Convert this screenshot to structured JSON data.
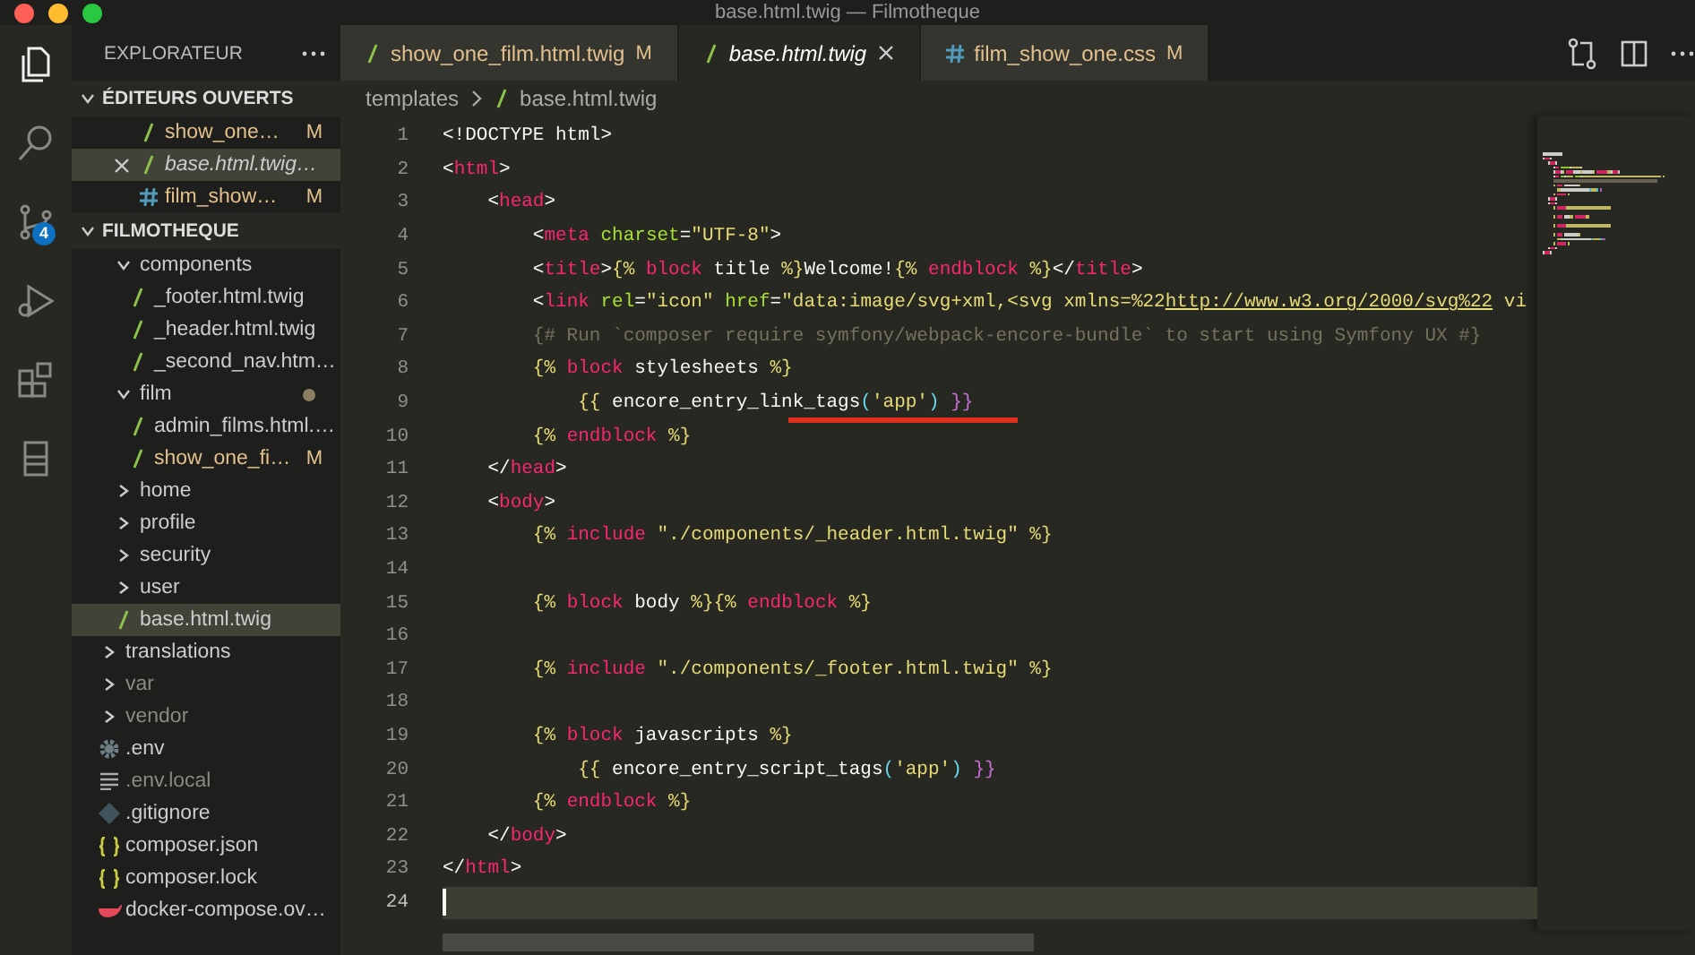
{
  "window": {
    "title": "base.html.twig — Filmotheque"
  },
  "activity_bar": [
    {
      "kind": "files",
      "selected": true
    },
    {
      "kind": "search",
      "selected": false
    },
    {
      "kind": "source-control",
      "selected": false,
      "badge": "4"
    },
    {
      "kind": "run",
      "selected": false
    },
    {
      "kind": "extensions",
      "selected": false
    },
    {
      "kind": "database",
      "selected": false
    }
  ],
  "sidebar": {
    "title": "EXPLORATEUR",
    "open_editors": {
      "title": "ÉDITEURS OUVERTS",
      "expanded": true,
      "items": [
        {
          "label": "show_one…",
          "kind": "twig",
          "badge": "M",
          "selected": false,
          "preview": false
        },
        {
          "label": "base.html.twig…",
          "kind": "twig",
          "selected": true,
          "preview": true
        },
        {
          "label": "film_show…",
          "kind": "css",
          "badge": "M",
          "selected": false,
          "preview": false
        }
      ]
    },
    "folder": {
      "title": "FILMOTHEQUE",
      "expanded": true,
      "tree": [
        {
          "children": [
            {
              "label": "components",
              "kind": "folder",
              "expanded": true,
              "dimmed": false,
              "selected": false,
              "children": [
                {
                  "label": "_footer.html.twig",
                  "kind": "twig",
                  "dimmed": false,
                  "selected": false
                },
                {
                  "label": "_header.html.twig",
                  "kind": "twig",
                  "dimmed": false,
                  "selected": false
                },
                {
                  "label": "_second_nav.htm…",
                  "kind": "twig",
                  "dimmed": false,
                  "selected": false
                }
              ]
            },
            {
              "label": "film",
              "kind": "folder",
              "expanded": true,
              "dimmed": false,
              "selected": false,
              "modified": true,
              "children": [
                {
                  "label": "admin_films.html.…",
                  "kind": "twig",
                  "dimmed": false,
                  "selected": false
                },
                {
                  "label": "show_one_fi…",
                  "kind": "twig",
                  "badge": "M",
                  "dimmed": false,
                  "selected": false
                }
              ]
            },
            {
              "label": "home",
              "kind": "folder",
              "expanded": false,
              "dimmed": false,
              "selected": false
            },
            {
              "label": "profile",
              "kind": "folder",
              "expanded": false,
              "dimmed": false,
              "selected": false
            },
            {
              "label": "security",
              "kind": "folder",
              "expanded": false,
              "dimmed": false,
              "selected": false
            },
            {
              "label": "user",
              "kind": "folder",
              "expanded": false,
              "dimmed": false,
              "selected": false
            },
            {
              "label": "base.html.twig",
              "kind": "twig",
              "dimmed": false,
              "selected": true
            }
          ]
        },
        {
          "label": "translations",
          "kind": "folder",
          "expanded": false,
          "dimmed": false,
          "selected": false
        },
        {
          "label": "var",
          "kind": "folder",
          "expanded": false,
          "dimmed": true,
          "selected": false
        },
        {
          "label": "vendor",
          "kind": "folder",
          "expanded": false,
          "dimmed": true,
          "selected": false
        },
        {
          "label": ".env",
          "kind": "gear",
          "dimmed": false,
          "selected": false
        },
        {
          "label": ".env.local",
          "kind": "lines",
          "dimmed": true,
          "selected": false
        },
        {
          "label": ".gitignore",
          "kind": "git",
          "dimmed": false,
          "selected": false
        },
        {
          "label": "composer.json",
          "kind": "json",
          "dimmed": false,
          "selected": false
        },
        {
          "label": "composer.lock",
          "kind": "json",
          "dimmed": false,
          "selected": false
        },
        {
          "label": "docker-compose.ov…",
          "kind": "docker",
          "dimmed": false,
          "selected": false
        }
      ]
    }
  },
  "tabs": [
    {
      "label": "show_one_film.html.twig",
      "kind": "twig",
      "badge": "M",
      "selected": false,
      "preview": false
    },
    {
      "label": "base.html.twig",
      "kind": "twig",
      "selected": true,
      "preview": true
    },
    {
      "label": "film_show_one.css",
      "kind": "css",
      "badge": "M",
      "selected": false,
      "preview": false
    }
  ],
  "breadcrumb": [
    {
      "label": "templates",
      "kind": "folder"
    },
    {
      "label": "base.html.twig",
      "kind": "twig"
    }
  ],
  "editor": {
    "lines": [
      {
        "number": "1",
        "current": false,
        "underlined": false,
        "tokens": [
          {
            "kind": "plain",
            "text": "<!DOCTYPE html>"
          }
        ]
      },
      {
        "number": "2",
        "current": false,
        "underlined": false,
        "tokens": [
          {
            "kind": "plain",
            "text": "<"
          },
          {
            "kind": "tag",
            "text": "html"
          },
          {
            "kind": "plain",
            "text": ">"
          }
        ]
      },
      {
        "number": "3",
        "current": false,
        "underlined": false,
        "tokens": [
          {
            "kind": "plain",
            "text": "    <"
          },
          {
            "kind": "tag",
            "text": "head"
          },
          {
            "kind": "plain",
            "text": ">"
          }
        ]
      },
      {
        "number": "4",
        "current": false,
        "underlined": false,
        "tokens": [
          {
            "kind": "plain",
            "text": "        <"
          },
          {
            "kind": "tag",
            "text": "meta"
          },
          {
            "kind": "attr",
            "text": " charset"
          },
          {
            "kind": "plain",
            "text": "="
          },
          {
            "kind": "string",
            "text": "\"UTF-8\""
          },
          {
            "kind": "plain",
            "text": ">"
          }
        ]
      },
      {
        "number": "5",
        "current": false,
        "underlined": false,
        "tokens": [
          {
            "kind": "plain",
            "text": "        <"
          },
          {
            "kind": "tag",
            "text": "title"
          },
          {
            "kind": "plain",
            "text": ">"
          },
          {
            "kind": "delim",
            "text": "{%"
          },
          {
            "kind": "tag",
            "text": " block"
          },
          {
            "kind": "plain",
            "text": " title "
          },
          {
            "kind": "delim",
            "text": "%}"
          },
          {
            "kind": "plain",
            "text": "Welcome!"
          },
          {
            "kind": "delim",
            "text": "{%"
          },
          {
            "kind": "tag",
            "text": " endblock"
          },
          {
            "kind": "delim",
            "text": " %}"
          },
          {
            "kind": "plain",
            "text": "</"
          },
          {
            "kind": "tag",
            "text": "title"
          },
          {
            "kind": "plain",
            "text": ">"
          }
        ]
      },
      {
        "number": "6",
        "current": false,
        "underlined": false,
        "tokens": [
          {
            "kind": "plain",
            "text": "        <"
          },
          {
            "kind": "tag",
            "text": "link"
          },
          {
            "kind": "attr",
            "text": " rel"
          },
          {
            "kind": "plain",
            "text": "="
          },
          {
            "kind": "string",
            "text": "\"icon\""
          },
          {
            "kind": "attr",
            "text": " href"
          },
          {
            "kind": "plain",
            "text": "="
          },
          {
            "kind": "string",
            "text": "\"data:image/svg+xml,<svg xmlns=%22"
          },
          {
            "kind": "link",
            "text": "http://www.w3.org/2000/svg%22"
          },
          {
            "kind": "string",
            "text": " vi"
          }
        ]
      },
      {
        "number": "7",
        "current": false,
        "underlined": false,
        "tokens": [
          {
            "kind": "comment",
            "text": "        {# Run `composer require symfony/webpack-encore-bundle` to start using Symfony UX #}"
          }
        ]
      },
      {
        "number": "8",
        "current": false,
        "underlined": false,
        "tokens": [
          {
            "kind": "delim",
            "text": "        {%"
          },
          {
            "kind": "tag",
            "text": " block"
          },
          {
            "kind": "plain",
            "text": " stylesheets "
          },
          {
            "kind": "delim",
            "text": "%}"
          }
        ]
      },
      {
        "number": "9",
        "current": false,
        "underlined": true,
        "tokens": [
          {
            "kind": "delim",
            "text": "            {{"
          },
          {
            "kind": "plain",
            "text": " encore_entry_link_tags"
          },
          {
            "kind": "paren",
            "text": "("
          },
          {
            "kind": "string",
            "text": "'app'"
          },
          {
            "kind": "paren",
            "text": ")"
          },
          {
            "kind": "brace",
            "text": " }}"
          }
        ]
      },
      {
        "number": "10",
        "current": false,
        "underlined": false,
        "tokens": [
          {
            "kind": "delim",
            "text": "        {%"
          },
          {
            "kind": "tag",
            "text": " endblock"
          },
          {
            "kind": "delim",
            "text": " %}"
          }
        ]
      },
      {
        "number": "11",
        "current": false,
        "underlined": false,
        "tokens": [
          {
            "kind": "plain",
            "text": "    </"
          },
          {
            "kind": "tag",
            "text": "head"
          },
          {
            "kind": "plain",
            "text": ">"
          }
        ]
      },
      {
        "number": "12",
        "current": false,
        "underlined": false,
        "tokens": [
          {
            "kind": "plain",
            "text": "    <"
          },
          {
            "kind": "tag",
            "text": "body"
          },
          {
            "kind": "plain",
            "text": ">"
          }
        ]
      },
      {
        "number": "13",
        "current": false,
        "underlined": false,
        "tokens": [
          {
            "kind": "delim",
            "text": "        {%"
          },
          {
            "kind": "tag",
            "text": " include"
          },
          {
            "kind": "string",
            "text": " \"./components/_header.html.twig\""
          },
          {
            "kind": "delim",
            "text": " %}"
          }
        ]
      },
      {
        "number": "14",
        "current": false,
        "underlined": false
      },
      {
        "number": "15",
        "current": false,
        "underlined": false,
        "tokens": [
          {
            "kind": "delim",
            "text": "        {%"
          },
          {
            "kind": "tag",
            "text": " block"
          },
          {
            "kind": "plain",
            "text": " body "
          },
          {
            "kind": "delim",
            "text": "%}{%"
          },
          {
            "kind": "tag",
            "text": " endblock"
          },
          {
            "kind": "delim",
            "text": " %}"
          }
        ]
      },
      {
        "number": "16",
        "current": false,
        "underlined": false
      },
      {
        "number": "17",
        "current": false,
        "underlined": false,
        "tokens": [
          {
            "kind": "delim",
            "text": "        {%"
          },
          {
            "kind": "tag",
            "text": " include"
          },
          {
            "kind": "string",
            "text": " \"./components/_footer.html.twig\""
          },
          {
            "kind": "delim",
            "text": " %}"
          }
        ]
      },
      {
        "number": "18",
        "current": false,
        "underlined": false
      },
      {
        "number": "19",
        "current": false,
        "underlined": false,
        "tokens": [
          {
            "kind": "delim",
            "text": "        {%"
          },
          {
            "kind": "tag",
            "text": " block"
          },
          {
            "kind": "plain",
            "text": " javascripts "
          },
          {
            "kind": "delim",
            "text": "%}"
          }
        ]
      },
      {
        "number": "20",
        "current": false,
        "underlined": false,
        "tokens": [
          {
            "kind": "delim",
            "text": "            {{"
          },
          {
            "kind": "plain",
            "text": " encore_entry_script_tags"
          },
          {
            "kind": "paren",
            "text": "("
          },
          {
            "kind": "string",
            "text": "'app'"
          },
          {
            "kind": "paren",
            "text": ")"
          },
          {
            "kind": "brace",
            "text": " }}"
          }
        ]
      },
      {
        "number": "21",
        "current": false,
        "underlined": false,
        "tokens": [
          {
            "kind": "delim",
            "text": "        {%"
          },
          {
            "kind": "tag",
            "text": " endblock"
          },
          {
            "kind": "delim",
            "text": " %}"
          }
        ]
      },
      {
        "number": "22",
        "current": false,
        "underlined": false,
        "tokens": [
          {
            "kind": "plain",
            "text": "    </"
          },
          {
            "kind": "tag",
            "text": "body"
          },
          {
            "kind": "plain",
            "text": ">"
          }
        ]
      },
      {
        "number": "23",
        "current": false,
        "underlined": false,
        "tokens": [
          {
            "kind": "plain",
            "text": "</"
          },
          {
            "kind": "tag",
            "text": "html"
          },
          {
            "kind": "plain",
            "text": ">"
          }
        ]
      },
      {
        "number": "24",
        "current": true,
        "underlined": false
      }
    ]
  }
}
